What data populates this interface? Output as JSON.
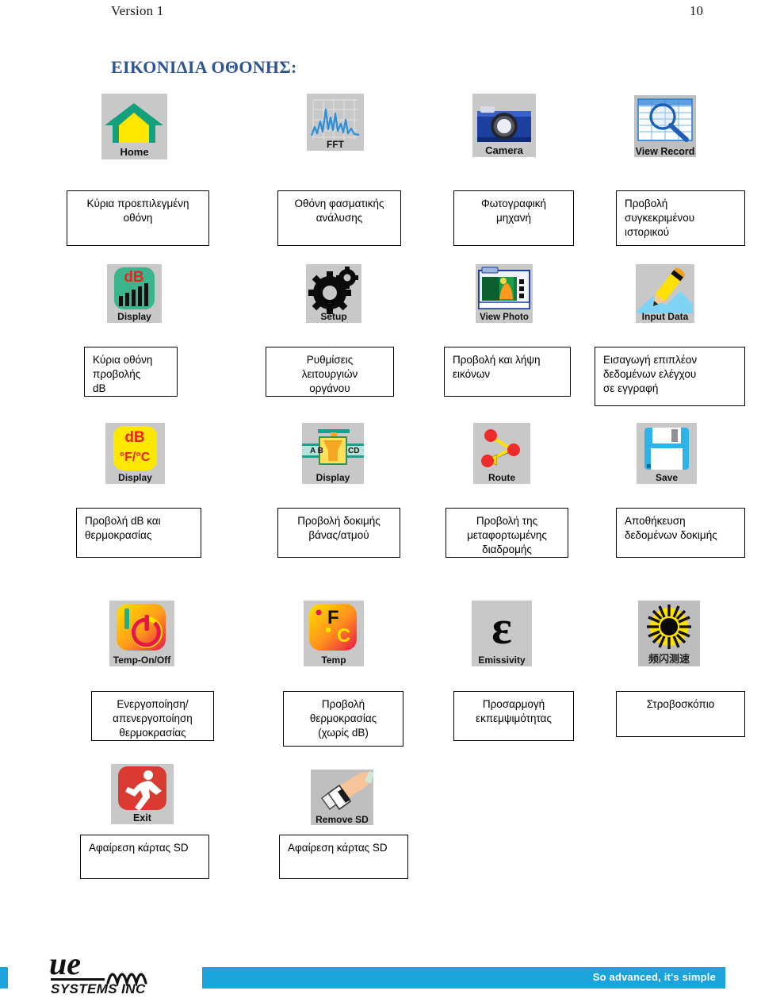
{
  "header": {
    "version": "Version 1",
    "page_number": "10"
  },
  "section_title": "ΕΙΚΟΝΙΔΙΑ ΟΘΟΝΗΣ:",
  "items": [
    {
      "icon_name": "home-icon",
      "icon_label": "Home",
      "caption": "Κύρια προεπιλεγμένη\nοθόνη"
    },
    {
      "icon_name": "fft-icon",
      "icon_label": "FFT",
      "caption": "Οθόνη φασματικής\nανάλυσης"
    },
    {
      "icon_name": "camera-icon",
      "icon_label": "Camera",
      "caption": "Φωτογραφική\nμηχανή"
    },
    {
      "icon_name": "view-record-icon",
      "icon_label": "View Record",
      "caption": "Προβολή\nσυγκεκριμένου\nιστορικού"
    },
    {
      "icon_name": "db-display-icon",
      "icon_label": "Display",
      "caption": "Κύρια οθόνη\nπροβολής\ndB"
    },
    {
      "icon_name": "setup-gears-icon",
      "icon_label": "Setup",
      "caption": "Ρυθμίσεις\nλειτουργιών\nοργάνου"
    },
    {
      "icon_name": "view-photo-icon",
      "icon_label": "View Photo",
      "caption": "Προβολή και λήψη\nεικόνων"
    },
    {
      "icon_name": "input-data-icon",
      "icon_label": "Input Data",
      "caption": "Εισαγωγή επιπλέον\nδεδομένων ελέγχου\nσε εγγραφή"
    },
    {
      "icon_name": "db-temp-display-icon",
      "icon_label": "Display",
      "caption": "Προβολή dB και\nθερμοκρασίας"
    },
    {
      "icon_name": "valve-display-icon",
      "icon_label": "Display",
      "caption": "Προβολή δοκιμής\nβάνας/ατμού"
    },
    {
      "icon_name": "route-icon",
      "icon_label": "Route",
      "caption": "Προβολή της\nμεταφορτωμένης\nδιαδρομής"
    },
    {
      "icon_name": "save-floppy-icon",
      "icon_label": "Save",
      "caption": "Αποθήκευση\nδεδομένων δοκιμής"
    },
    {
      "icon_name": "temp-on-off-icon",
      "icon_label": "Temp-On/Off",
      "caption": "Ενεργοποίηση/\nαπενεργοποίηση\nθερμοκρασίας"
    },
    {
      "icon_name": "temp-fc-icon",
      "icon_label": "Temp",
      "caption": "Προβολή\nθερμοκρασίας\n(χωρίς dB)"
    },
    {
      "icon_name": "emissivity-icon",
      "icon_label": "Emissivity",
      "caption": "Προσαρμογή\nεκπεμψιμότητας"
    },
    {
      "icon_name": "strobe-icon",
      "icon_label": "频闪测速",
      "caption": "Στροβοσκόπιο"
    },
    {
      "icon_name": "exit-icon",
      "icon_label": "Exit",
      "caption": "Αφαίρεση κάρτας SD"
    },
    {
      "icon_name": "remove-sd-icon",
      "icon_label": "Remove SD",
      "caption": "Αφαίρεση κάρτας SD"
    }
  ],
  "footer": {
    "logo_mark": "ue",
    "logo_sub": "SYSTEMS INC",
    "tagline": "So advanced, it's simple"
  },
  "colors": {
    "heading_blue": "#2e5496",
    "icon_bg_gray": "#c8c8c8",
    "brand_cyan": "#1ba3dc",
    "home_green": "#14a07c",
    "home_yellow": "#ffe800",
    "db_red": "#f02020",
    "accent_blue": "#2a7fd4"
  }
}
